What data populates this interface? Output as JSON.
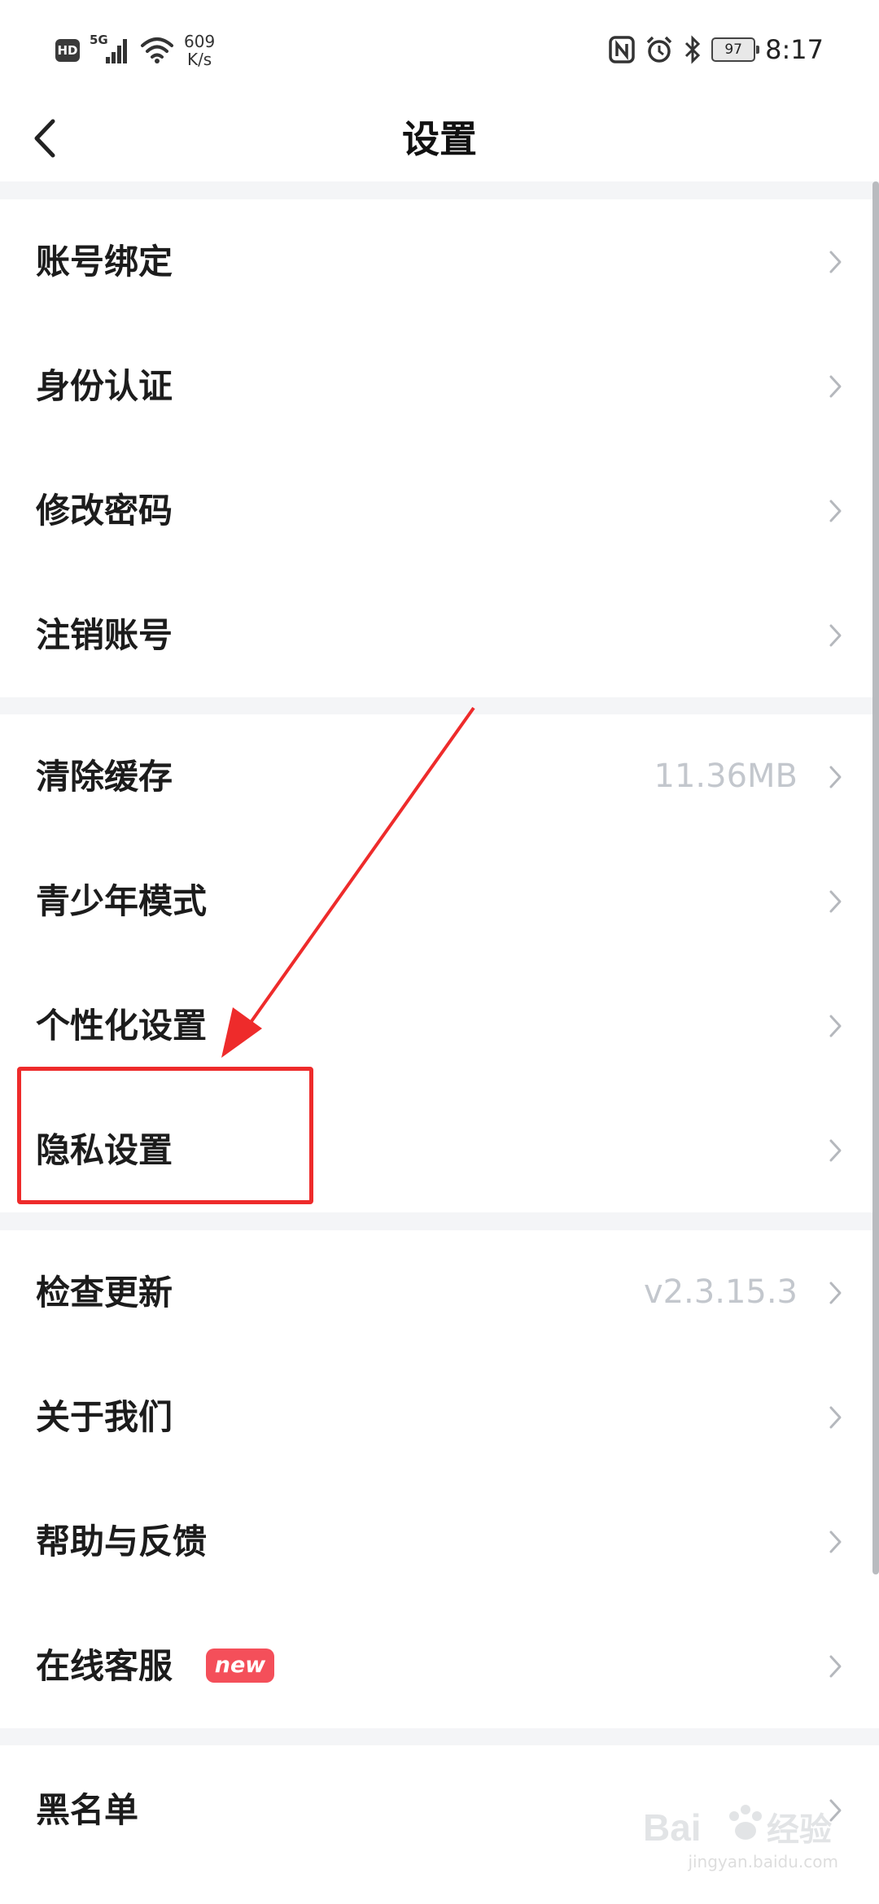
{
  "status_bar": {
    "hd_badge": "HD",
    "signal_label": "5G",
    "net_speed_value": "609",
    "net_speed_unit": "K/s",
    "battery_level": "97",
    "time": "8:17"
  },
  "nav": {
    "title": "设置",
    "back_icon": "chevron-left-icon"
  },
  "groups": [
    {
      "rows": [
        {
          "label": "账号绑定"
        },
        {
          "label": "身份认证"
        },
        {
          "label": "修改密码"
        },
        {
          "label": "注销账号"
        }
      ]
    },
    {
      "rows": [
        {
          "label": "清除缓存",
          "value": "11.36MB"
        },
        {
          "label": "青少年模式"
        },
        {
          "label": "个性化设置"
        },
        {
          "label": "隐私设置"
        }
      ]
    },
    {
      "rows": [
        {
          "label": "检查更新",
          "value": "v2.3.15.3"
        },
        {
          "label": "关于我们"
        },
        {
          "label": "帮助与反馈"
        },
        {
          "label": "在线客服",
          "badge": "new"
        }
      ]
    },
    {
      "rows": [
        {
          "label": "黑名单"
        }
      ]
    }
  ],
  "watermark": {
    "text": "jingyan.baidu.com"
  },
  "colors": {
    "badge": "#f44f5a",
    "annotation": "#ee2b2b",
    "value_text": "#c3c7cd",
    "background": "#f4f5f7"
  }
}
